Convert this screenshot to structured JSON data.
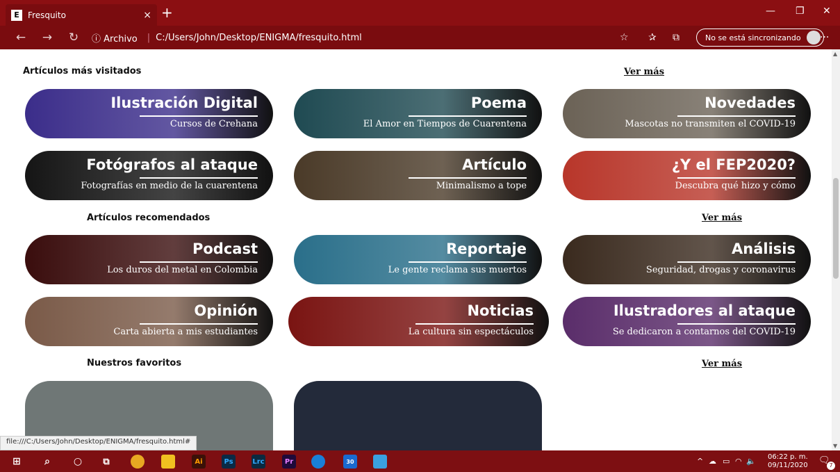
{
  "browser": {
    "tab_title": "Fresquito",
    "tab_favicon": "E",
    "tab_close": "×",
    "new_tab": "+",
    "back": "←",
    "forward": "→",
    "refresh": "↻",
    "url_info": "ⓘ Archivo",
    "url_path": "C:/Users/John/Desktop/ENIGMA/fresquito.html",
    "sync_label": "No se está sincronizando",
    "menu": "···",
    "status_url": "file:///C:/Users/John/Desktop/ENIGMA/fresquito.html#"
  },
  "sections": {
    "visitados": {
      "title": "Artículos más visitados",
      "ver_mas": "Ver más"
    },
    "recomendados": {
      "title": "Artículos recomendados",
      "ver_mas": "Ver más"
    },
    "favoritos": {
      "title": "Nuestros favoritos",
      "ver_mas": "Ver más"
    }
  },
  "cards": [
    {
      "title": "Ilustración Digital",
      "subtitle": "Cursos de Crehana",
      "bg": "#3b2d8a"
    },
    {
      "title": "Poema",
      "subtitle": "El Amor en Tiempos de Cuarentena",
      "bg": "#1f4a52"
    },
    {
      "title": "Novedades",
      "subtitle": "Mascotas no transmiten el COVID-19",
      "bg": "#6b6256"
    },
    {
      "title": "Fotógrafos al ataque",
      "subtitle": "Fotografías en medio de la cuarentena",
      "bg": "#151515"
    },
    {
      "title": "Artículo",
      "subtitle": "Minimalismo a tope",
      "bg": "#4a3a28"
    },
    {
      "title": "¿Y el FEP2020?",
      "subtitle": "Descubra qué hizo y cómo",
      "bg": "#b8362a"
    },
    {
      "title": "Podcast",
      "subtitle": "Los duros del metal en Colombia",
      "bg": "#3a0d0d"
    },
    {
      "title": "Reportaje",
      "subtitle": "Le gente reclama sus muertos",
      "bg": "#2a6f8a"
    },
    {
      "title": "Análisis",
      "subtitle": "Seguridad, drogas y coronavirus",
      "bg": "#3a2a1e"
    },
    {
      "title": "Opinión",
      "subtitle": "Carta abierta a mis estudiantes",
      "bg": "#7a5a48"
    },
    {
      "title": "Noticias",
      "subtitle": "La cultura sin espectáculos",
      "bg": "#7a1412"
    },
    {
      "title": "Ilustradores al ataque",
      "subtitle": "Se dedicaron a contarnos del COVID-19",
      "bg": "#5a2d6a"
    }
  ],
  "taskbar": {
    "apps": [
      "Ai",
      "Ps",
      "Lrc",
      "Pr"
    ],
    "badge": "30",
    "time": "06:22 p. m.",
    "date": "09/11/2020",
    "notifications": "7"
  }
}
